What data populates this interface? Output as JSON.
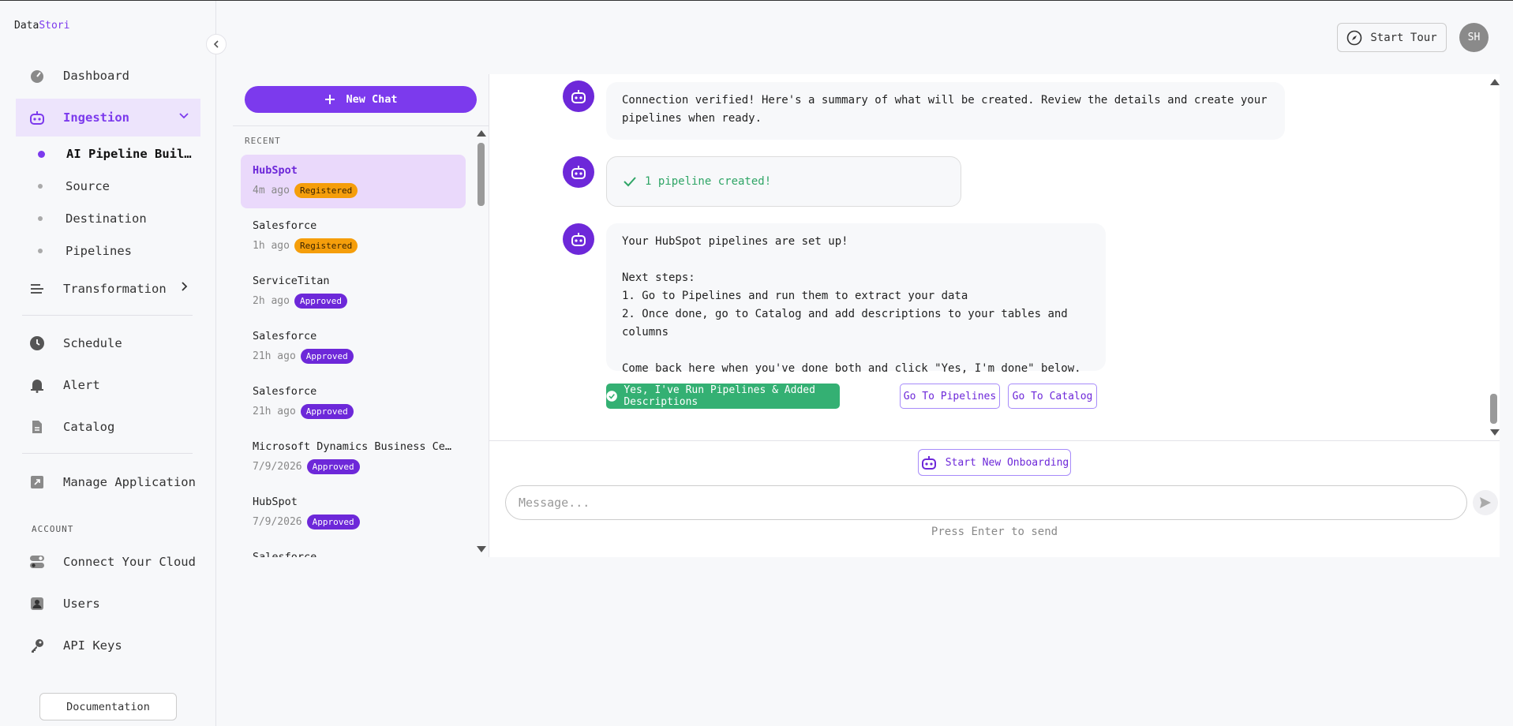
{
  "brand": {
    "name_part1": "Data",
    "name_part2": "Stori"
  },
  "sidebar": {
    "nav": [
      {
        "label": "Dashboard",
        "icon": "gauge-icon"
      },
      {
        "label": "Ingestion",
        "icon": "robot-icon"
      },
      {
        "label": "Transformation",
        "icon": "bars-icon"
      },
      {
        "label": "Schedule",
        "icon": "clock-icon"
      },
      {
        "label": "Alert",
        "icon": "bell-icon"
      },
      {
        "label": "Catalog",
        "icon": "document-icon"
      },
      {
        "label": "Manage Application",
        "icon": "external-link-icon"
      }
    ],
    "ingestion_sub": [
      {
        "label": "AI Pipeline Buil…"
      },
      {
        "label": "Source"
      },
      {
        "label": "Destination"
      },
      {
        "label": "Pipelines"
      }
    ],
    "account_label": "ACCOUNT",
    "account_items": [
      {
        "label": "Connect Your Cloud",
        "icon": "toggle-icon"
      },
      {
        "label": "Users",
        "icon": "user-icon"
      },
      {
        "label": "API Keys",
        "icon": "key-icon"
      }
    ],
    "documentation": "Documentation"
  },
  "header": {
    "start_tour": "Start Tour",
    "avatar_initials": "SH"
  },
  "chatlist": {
    "new_chat": "New Chat",
    "recent_label": "RECENT",
    "items": [
      {
        "name": "HubSpot",
        "time": "4m ago",
        "status": "Registered"
      },
      {
        "name": "Salesforce",
        "time": "1h ago",
        "status": "Registered"
      },
      {
        "name": "ServiceTitan",
        "time": "2h ago",
        "status": "Approved"
      },
      {
        "name": "Salesforce",
        "time": "21h ago",
        "status": "Approved"
      },
      {
        "name": "Salesforce",
        "time": "21h ago",
        "status": "Approved"
      },
      {
        "name": "Microsoft Dynamics Business Cen…",
        "time": "7/9/2026",
        "status": "Approved"
      },
      {
        "name": "HubSpot",
        "time": "7/9/2026",
        "status": "Approved"
      },
      {
        "name": "Salesforce",
        "time": "",
        "status": ""
      }
    ]
  },
  "chat": {
    "messages": [
      {
        "line1": "Connection verified! Here's a summary of what will be created. Review the details and create your",
        "line2": "pipelines when ready."
      },
      {
        "text": "1 pipeline created!"
      },
      {
        "l1": "Your HubSpot pipelines are set up!",
        "l2": "Next steps:",
        "l3": "1. Go to Pipelines and run them to extract your data",
        "l4": "2. Once done, go to Catalog and add descriptions to your tables and columns",
        "l5": "Come back here when you've done both and click \"Yes, I'm done\" below."
      }
    ],
    "actions": {
      "confirm": "Yes, I've Run Pipelines & Added Descriptions",
      "pipelines": "Go To Pipelines",
      "catalog": "Go To Catalog"
    },
    "start_onboarding": "Start New Onboarding",
    "input_placeholder": "Message...",
    "hint": "Press Enter to send"
  },
  "colors": {
    "accent": "#7c3aed",
    "success": "#34b073",
    "registered": "#f59e0b"
  }
}
